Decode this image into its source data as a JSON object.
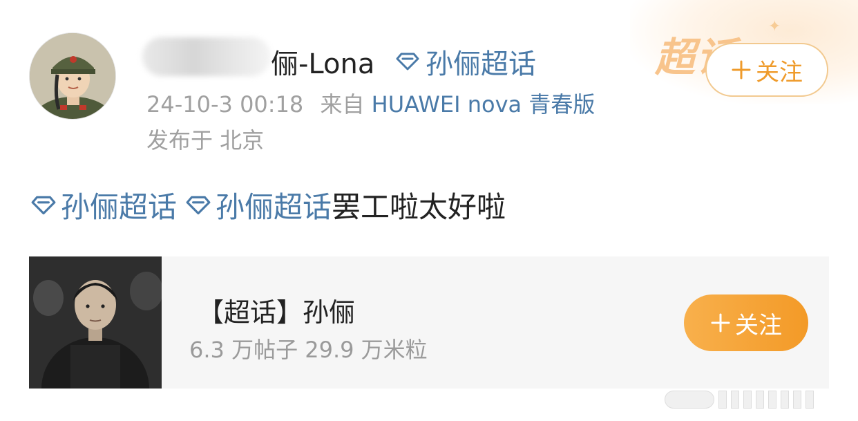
{
  "header": {
    "username_suffix": "俪-Lona",
    "topic_link": "孙俪超话",
    "post_time": "24-10-3 00:18",
    "source_prefix": "来自",
    "device": "HUAWEI nova 青春版",
    "location": "发布于 北京",
    "follow_label": "关注",
    "corner_badge": "超话"
  },
  "post": {
    "tags": [
      "孙俪超话",
      "孙俪超话"
    ],
    "text": "罢工啦太好啦"
  },
  "topic_card": {
    "title": "【超话】孙俪",
    "stats": "6.3 万帖子 29.9 万米粒",
    "follow_label": "关注"
  },
  "colors": {
    "link": "#4a7aa8",
    "accent": "#f39a27",
    "muted": "#a0a0a0"
  },
  "icons": {
    "topic": "diamond-icon",
    "follow": "plus-icon"
  }
}
